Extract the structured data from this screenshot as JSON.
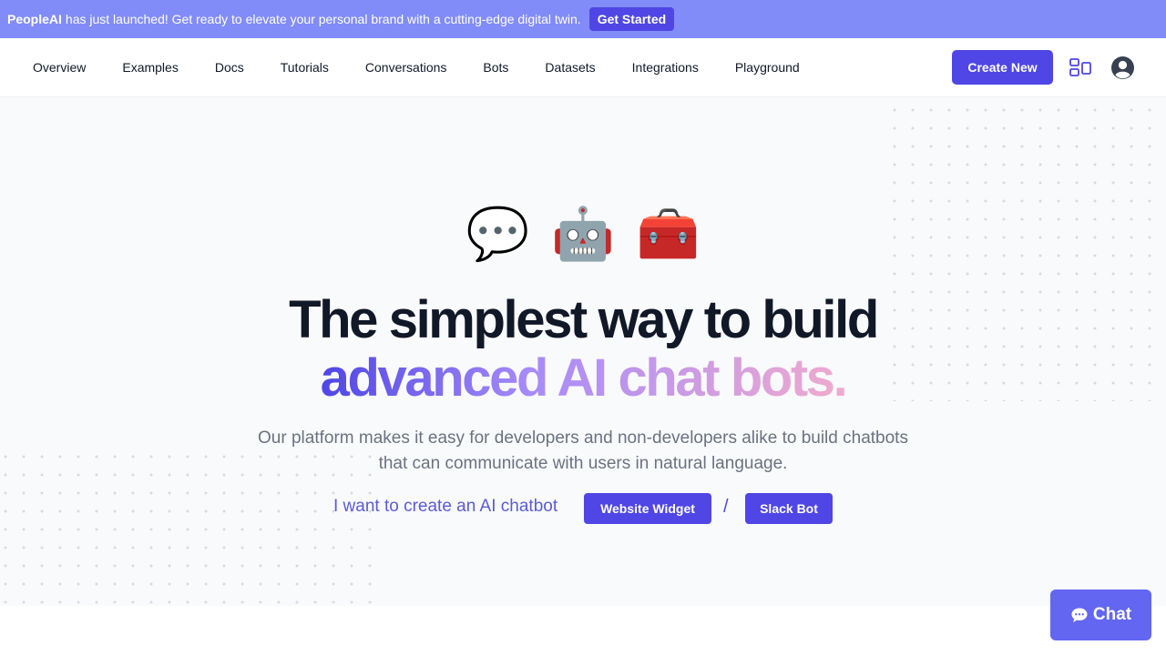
{
  "announcement": {
    "brand": "PeopleAI",
    "text": "has just launched! Get ready to elevate your personal brand with a cutting-edge digital twin.",
    "button_label": "Get Started"
  },
  "nav": {
    "links": [
      "Overview",
      "Examples",
      "Docs",
      "Tutorials",
      "Conversations",
      "Bots",
      "Datasets",
      "Integrations",
      "Playground"
    ],
    "create_label": "Create New",
    "icons": [
      "layout-icon",
      "user-avatar-icon"
    ]
  },
  "hero": {
    "emojis": [
      "💬",
      "🤖",
      "🧰"
    ],
    "title_line1": "The simplest way to build",
    "title_line2": "advanced AI chat bots.",
    "subtitle_line1": "Our platform makes it easy for developers and non-developers alike to build chatbots",
    "subtitle_line2": "that can communicate with users in natural language.",
    "cta_label": "I want to create an AI chatbot",
    "cta_website": "Website Widget",
    "cta_separator": "/",
    "cta_slack": "Slack Bot"
  },
  "chat_widget": {
    "label": "Chat",
    "icon": "chat-bubble-icon"
  },
  "colors": {
    "primary": "#4f46e5",
    "announce_bg": "#818cf8",
    "hero_bg": "#f9fafb",
    "chat_bg": "#6366f1"
  }
}
